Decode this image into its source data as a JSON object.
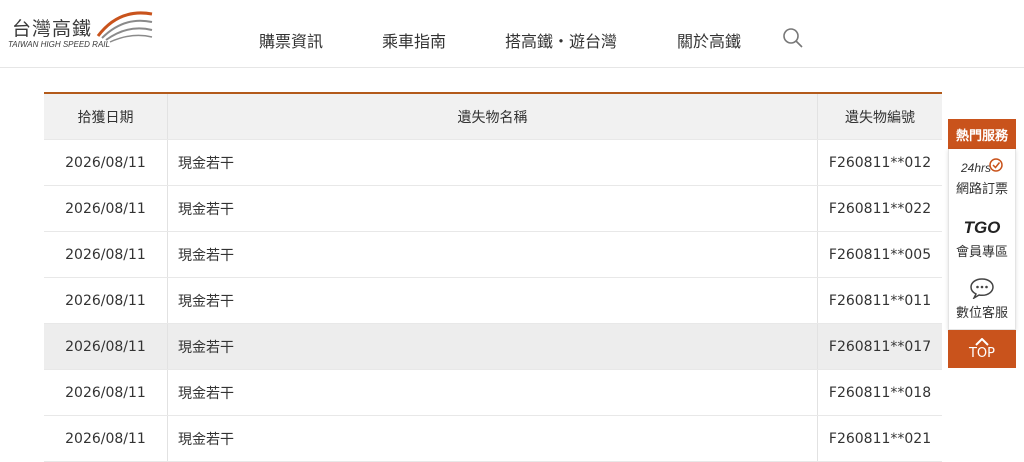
{
  "brand": {
    "name_cn": "台灣高鐵",
    "name_en": "TAIWAN HIGH SPEED RAIL",
    "accent_color": "#c9531c"
  },
  "nav": {
    "items": [
      "購票資訊",
      "乘車指南",
      "搭高鐵・遊台灣",
      "關於高鐵"
    ]
  },
  "table": {
    "headers": [
      "拾獲日期",
      "遺失物名稱",
      "遺失物編號"
    ],
    "rows": [
      {
        "date": "2026/08/11",
        "name": "現金若干",
        "id": "F260811**012"
      },
      {
        "date": "2026/08/11",
        "name": "現金若干",
        "id": "F260811**022"
      },
      {
        "date": "2026/08/11",
        "name": "現金若干",
        "id": "F260811**005"
      },
      {
        "date": "2026/08/11",
        "name": "現金若干",
        "id": "F260811**011"
      },
      {
        "date": "2026/08/11",
        "name": "現金若干",
        "id": "F260811**017"
      },
      {
        "date": "2026/08/11",
        "name": "現金若干",
        "id": "F260811**018"
      },
      {
        "date": "2026/08/11",
        "name": "現金若干",
        "id": "F260811**021"
      }
    ]
  },
  "sidebar": {
    "title": "熱門服務",
    "items": [
      {
        "icon_text": "24hrs",
        "label": "網路訂票",
        "icon": "clock-icon"
      },
      {
        "icon_text": "TGO",
        "label": "會員專區",
        "icon": "tgo-logo-icon"
      },
      {
        "label": "數位客服",
        "icon": "chat-bubble-icon"
      }
    ],
    "top_label": "TOP"
  }
}
